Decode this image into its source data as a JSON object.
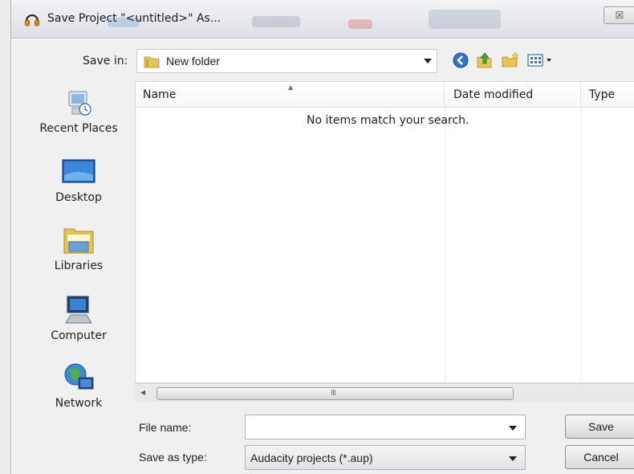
{
  "window": {
    "title": "Save Project \"<untitled>\" As...",
    "close_glyph": "☒"
  },
  "toolbar": {
    "save_in_label": "Save in:",
    "save_in_value": "New folder",
    "icons": [
      "back-icon",
      "up-folder-icon",
      "new-folder-icon",
      "view-menu-icon"
    ]
  },
  "places": [
    {
      "label": "Recent Places",
      "icon": "recent-places-icon"
    },
    {
      "label": "Desktop",
      "icon": "desktop-icon"
    },
    {
      "label": "Libraries",
      "icon": "libraries-icon"
    },
    {
      "label": "Computer",
      "icon": "computer-icon"
    },
    {
      "label": "Network",
      "icon": "network-icon"
    }
  ],
  "filelist": {
    "columns": [
      "Name",
      "Date modified",
      "Type"
    ],
    "empty_message": "No items match your search."
  },
  "scrollbar": {
    "left_arrow": "◂",
    "grip": "III"
  },
  "form": {
    "file_name_label": "File name:",
    "file_name_value": "",
    "save_as_type_label": "Save as type:",
    "save_as_type_value": "Audacity projects (*.aup)"
  },
  "buttons": {
    "save": "Save",
    "cancel": "Cancel"
  }
}
